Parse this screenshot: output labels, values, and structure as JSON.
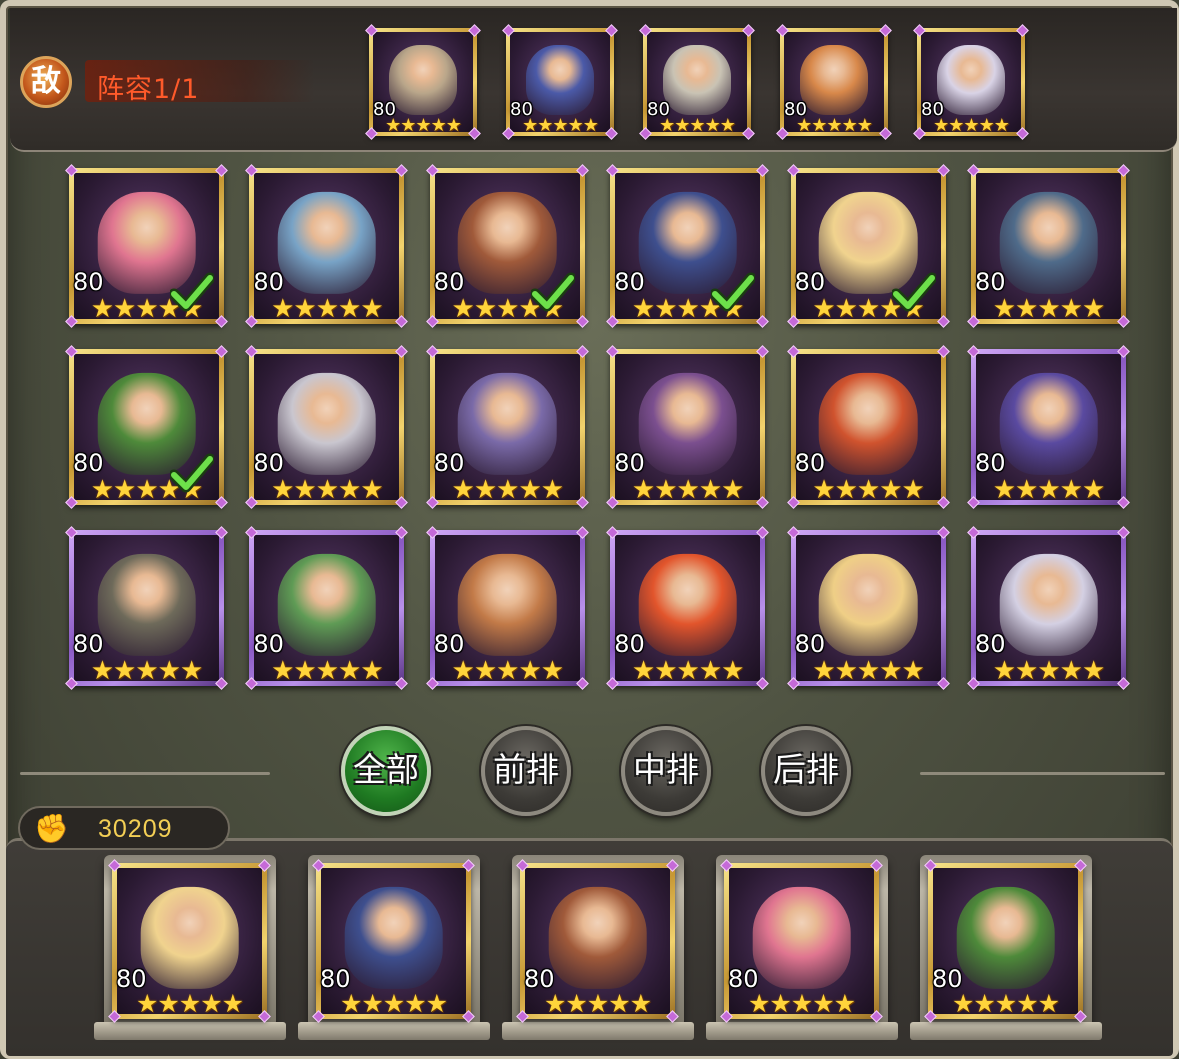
{
  "enemy": {
    "badge": "敌",
    "lineup_label": "阵容1/1",
    "heroes": [
      {
        "level": "80",
        "stars": 5,
        "hue": "#b9a68a"
      },
      {
        "level": "80",
        "stars": 5,
        "hue": "#4b5aa8"
      },
      {
        "level": "80",
        "stars": 5,
        "hue": "#c9c3b4"
      },
      {
        "level": "80",
        "stars": 5,
        "hue": "#d8884a"
      },
      {
        "level": "80",
        "stars": 5,
        "hue": "#d9d3e6"
      }
    ]
  },
  "roster": [
    {
      "level": "80",
      "stars": 5,
      "frame": "gold",
      "selected": true,
      "hue": "#e07590"
    },
    {
      "level": "80",
      "stars": 5,
      "frame": "gold",
      "selected": false,
      "hue": "#78a3c6"
    },
    {
      "level": "80",
      "stars": 5,
      "frame": "gold",
      "selected": true,
      "hue": "#a05a3a"
    },
    {
      "level": "80",
      "stars": 5,
      "frame": "gold",
      "selected": true,
      "hue": "#3e4f8e"
    },
    {
      "level": "80",
      "stars": 5,
      "frame": "gold",
      "selected": true,
      "hue": "#f0d38e"
    },
    {
      "level": "80",
      "stars": 5,
      "frame": "gold",
      "selected": false,
      "hue": "#4f6b8a"
    },
    {
      "level": "80",
      "stars": 5,
      "frame": "gold",
      "selected": true,
      "hue": "#4e8a3a"
    },
    {
      "level": "80",
      "stars": 5,
      "frame": "gold",
      "selected": false,
      "hue": "#c9c6cf"
    },
    {
      "level": "80",
      "stars": 5,
      "frame": "gold",
      "selected": false,
      "hue": "#7a6aa8"
    },
    {
      "level": "80",
      "stars": 5,
      "frame": "gold",
      "selected": false,
      "hue": "#7b4f8f"
    },
    {
      "level": "80",
      "stars": 5,
      "frame": "gold",
      "selected": false,
      "hue": "#d0532e"
    },
    {
      "level": "80",
      "stars": 5,
      "frame": "purple",
      "selected": false,
      "hue": "#5a4aa0"
    },
    {
      "level": "80",
      "stars": 5,
      "frame": "purple",
      "selected": false,
      "hue": "#6e6a5a"
    },
    {
      "level": "80",
      "stars": 5,
      "frame": "purple",
      "selected": false,
      "hue": "#5f9b55"
    },
    {
      "level": "80",
      "stars": 5,
      "frame": "purple",
      "selected": false,
      "hue": "#c27a48"
    },
    {
      "level": "80",
      "stars": 5,
      "frame": "purple",
      "selected": false,
      "hue": "#e2552c"
    },
    {
      "level": "80",
      "stars": 5,
      "frame": "purple",
      "selected": false,
      "hue": "#efcf86"
    },
    {
      "level": "80",
      "stars": 5,
      "frame": "purple",
      "selected": false,
      "hue": "#d4d0e3"
    }
  ],
  "filters": [
    {
      "label": "全部",
      "active": true
    },
    {
      "label": "前排",
      "active": false
    },
    {
      "label": "中排",
      "active": false
    },
    {
      "label": "后排",
      "active": false
    }
  ],
  "power": {
    "icon": "fist-icon",
    "value": "30209"
  },
  "team": [
    {
      "level": "80",
      "stars": 5,
      "hue": "#f0d38e"
    },
    {
      "level": "80",
      "stars": 5,
      "hue": "#3e4f8e"
    },
    {
      "level": "80",
      "stars": 5,
      "hue": "#a05a3a"
    },
    {
      "level": "80",
      "stars": 5,
      "hue": "#e07590"
    },
    {
      "level": "80",
      "stars": 5,
      "hue": "#4e8a3a"
    }
  ]
}
